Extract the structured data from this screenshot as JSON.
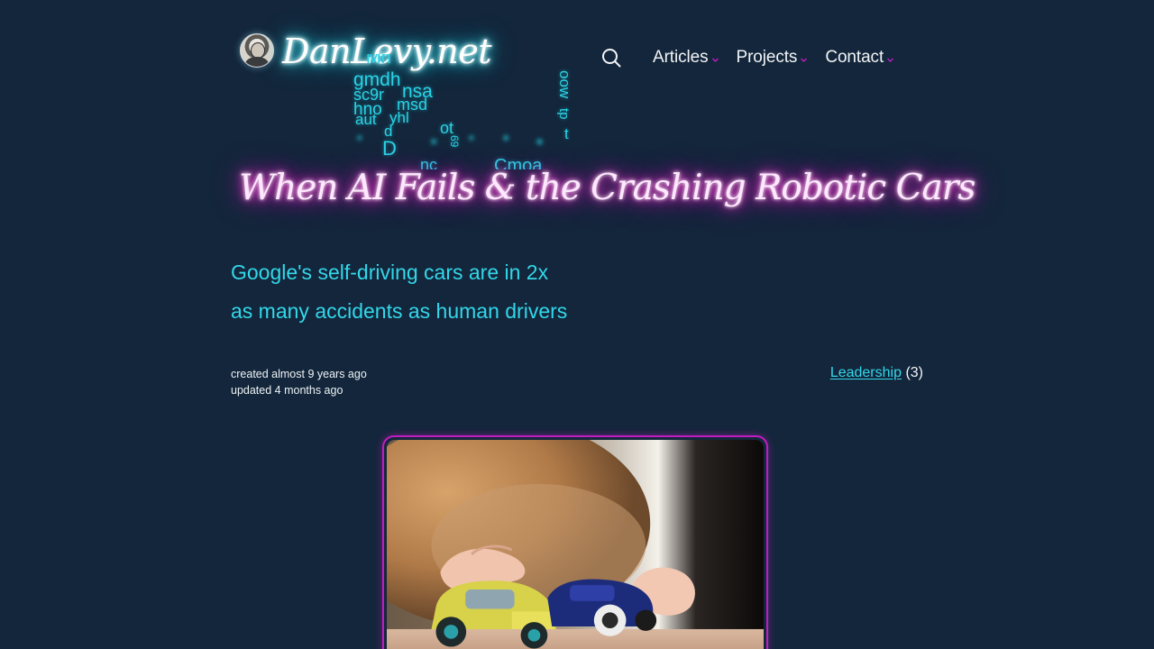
{
  "header": {
    "brand": "DanLevy.net",
    "avatar_alt": "Dan Levy avatar",
    "search_icon": "search-icon",
    "nav": [
      {
        "label": "Articles",
        "chevron": "chevron-down-icon"
      },
      {
        "label": "Projects",
        "chevron": "chevron-down-icon"
      },
      {
        "label": "Contact",
        "chevron": "chevron-down-icon"
      }
    ],
    "word_cloud": [
      "gmdh",
      "nsa",
      "sc9r",
      "hno",
      "msd",
      "aut",
      "yhl",
      "ot",
      "d",
      "D",
      "nc",
      "Cmoa",
      "oow",
      "tp",
      "t",
      "69",
      "Mh"
    ]
  },
  "post": {
    "title": "When AI Fails & the Crashing Robotic Cars",
    "subtitle_line1": "Google's self-driving cars are in 2x",
    "subtitle_line2": "as many accidents as human drivers",
    "created": "created almost 9 years ago",
    "updated": "updated 4 months ago",
    "tag": "Leadership",
    "tag_count": "(3)",
    "hero_alt": "Child playing with toy cars"
  },
  "colors": {
    "background": "#13263b",
    "accent_cyan": "#33d7ea",
    "accent_magenta": "#c21cc0",
    "brand_glow": "#27e2f0",
    "title_glow": "#e51dc4",
    "text": "#f2f4f6"
  }
}
